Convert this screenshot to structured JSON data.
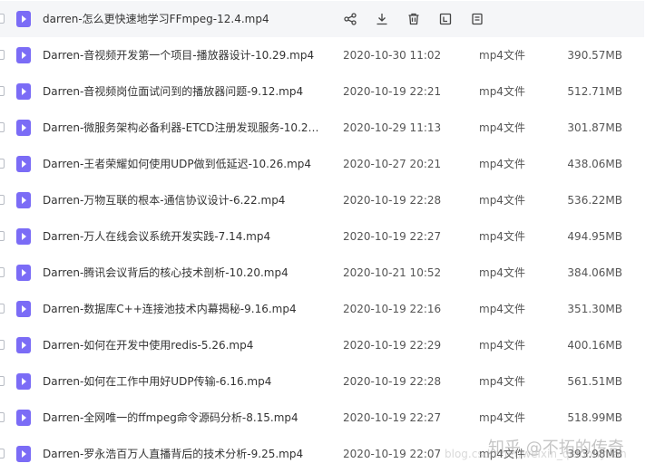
{
  "columns": {
    "type_label": "mp4文件"
  },
  "hovered_row": {
    "name": "darren-怎么更快速地学习FFmpeg-12.4.mp4",
    "actions": [
      {
        "name": "share-icon"
      },
      {
        "name": "download-icon"
      },
      {
        "name": "delete-icon"
      },
      {
        "name": "rename-icon"
      },
      {
        "name": "more-icon"
      }
    ]
  },
  "files": [
    {
      "name": "Darren-音视频开发第一个项目-播放器设计-10.29.mp4",
      "date": "2020-10-30 11:02",
      "type": "mp4文件",
      "size": "390.57MB"
    },
    {
      "name": "Darren-音视频岗位面试问到的播放器问题-9.12.mp4",
      "date": "2020-10-19 22:21",
      "type": "mp4文件",
      "size": "512.71MB"
    },
    {
      "name": "Darren-微服务架构必备利器-ETCD注册发现服务-10.29....",
      "date": "2020-10-29 11:13",
      "type": "mp4文件",
      "size": "301.87MB"
    },
    {
      "name": "Darren-王者荣耀如何使用UDP做到低延迟-10.26.mp4",
      "date": "2020-10-27 20:21",
      "type": "mp4文件",
      "size": "438.06MB"
    },
    {
      "name": "Darren-万物互联的根本-通信协议设计-6.22.mp4",
      "date": "2020-10-19 22:28",
      "type": "mp4文件",
      "size": "536.22MB"
    },
    {
      "name": "Darren-万人在线会议系统开发实践-7.14.mp4",
      "date": "2020-10-19 22:27",
      "type": "mp4文件",
      "size": "494.95MB"
    },
    {
      "name": "Darren-腾讯会议背后的核心技术剖析-10.20.mp4",
      "date": "2020-10-21 10:52",
      "type": "mp4文件",
      "size": "384.06MB"
    },
    {
      "name": "Darren-数据库C++连接池技术内幕揭秘-9.16.mp4",
      "date": "2020-10-19 22:16",
      "type": "mp4文件",
      "size": "351.30MB"
    },
    {
      "name": "Darren-如何在开发中使用redis-5.26.mp4",
      "date": "2020-10-19 22:29",
      "type": "mp4文件",
      "size": "400.16MB"
    },
    {
      "name": "Darren-如何在工作中用好UDP传输-6.16.mp4",
      "date": "2020-10-19 22:28",
      "type": "mp4文件",
      "size": "561.51MB"
    },
    {
      "name": "Darren-全网唯一的ffmpeg命令源码分析-8.15.mp4",
      "date": "2020-10-19 22:27",
      "type": "mp4文件",
      "size": "518.99MB"
    },
    {
      "name": "Darren-罗永浩百万人直播背后的技术分析-9.25.mp4",
      "date": "2020-10-19 22:07",
      "type": "mp4文件",
      "size": "393.98MB"
    }
  ],
  "watermark": {
    "text": "知乎 @不拓的传奇",
    "url": "blog.csdn.net/weixin_qianhuyuan"
  },
  "colors": {
    "file_icon": "#7b6cf6",
    "hover_bg": "#f5f6f8",
    "text": "#333333"
  }
}
